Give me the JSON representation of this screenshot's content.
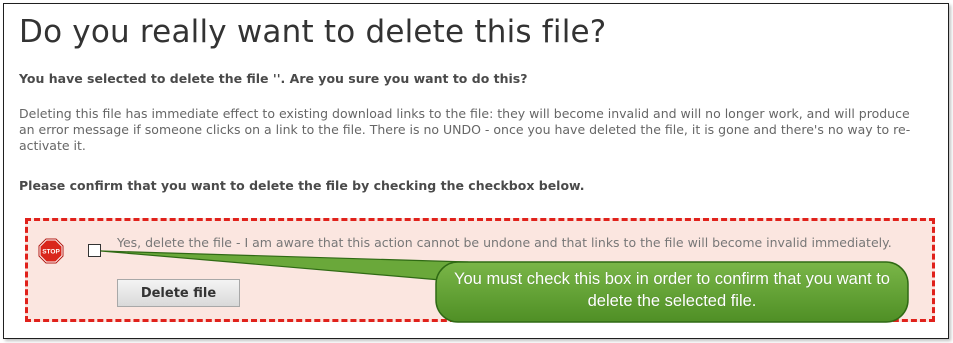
{
  "dialog": {
    "title": "Do you really want to delete this file?",
    "subtitle": "You have selected to delete the file ''. Are you sure you want to do this?",
    "warning_text": "Deleting this file has immediate effect to existing download links to the file: they will become invalid and will no longer work, and will produce an error message if someone clicks on a link to the file. There is no UNDO - once you have deleted the file, it is gone and there's no way to re-activate it.",
    "instruction": "Please confirm that you want to delete the file by checking the checkbox below.",
    "confirm": {
      "stop_icon_text": "STOP",
      "checkbox_checked": false,
      "checkbox_label": "Yes, delete the file - I am aware that this action cannot be undone and that links to the file will become invalid immediately.",
      "delete_button_label": "Delete file"
    }
  },
  "callout": {
    "text": "You must check this box in order to confirm that you want to delete the selected file."
  },
  "colors": {
    "confirm_border": "#e0211b",
    "confirm_background": "#fbe6e0",
    "stop_red": "#d9261c",
    "callout_green": "#5a9c2e"
  }
}
